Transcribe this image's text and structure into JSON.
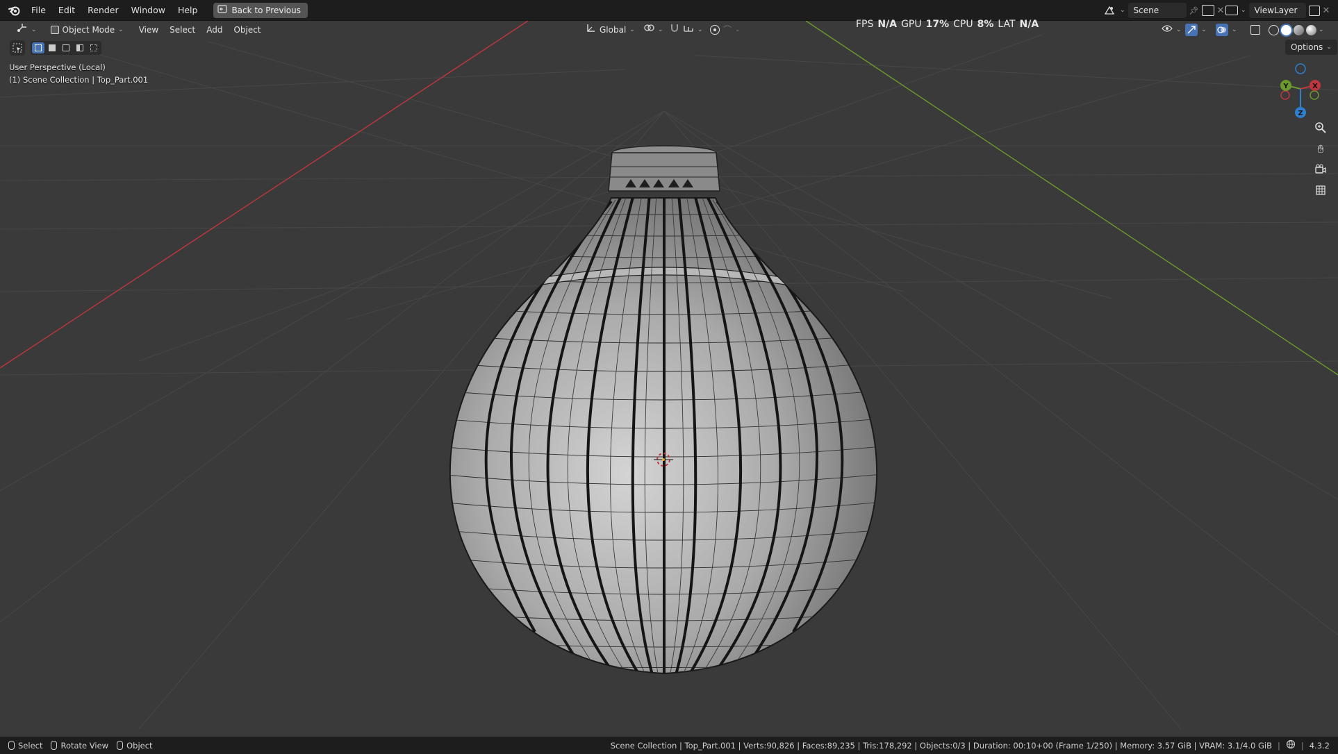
{
  "menu": {
    "items": [
      "File",
      "Edit",
      "Render",
      "Window",
      "Help"
    ],
    "back_button": "Back to Previous"
  },
  "scene_selector": {
    "value": "Scene"
  },
  "viewlayer_selector": {
    "value": "ViewLayer"
  },
  "viewport_header": {
    "mode": "Object Mode",
    "menus": [
      "View",
      "Select",
      "Add",
      "Object"
    ],
    "transform_orientation": "Global",
    "options_label": "Options"
  },
  "stats": {
    "fps_label": "FPS",
    "fps_value": "N/A",
    "gpu_label": "GPU",
    "gpu_value": "17%",
    "cpu_label": "CPU",
    "cpu_value": "8%",
    "lat_label": "LAT",
    "lat_value": "N/A"
  },
  "viewport_info": {
    "perspective": "User Perspective (Local)",
    "collection": "(1) Scene Collection | Top_Part.001"
  },
  "gizmo": {
    "x": "X",
    "y": "Y",
    "z": "Z"
  },
  "status_bar": {
    "left": [
      {
        "label": "Select"
      },
      {
        "label": "Rotate View"
      },
      {
        "label": "Object"
      }
    ],
    "info": "Scene Collection | Top_Part.001 | Verts:90,826 | Faces:89,235 | Tris:178,292 | Objects:0/3 | Duration: 00:10+00 (Frame 1/250) | Memory: 3.57 GiB | VRAM: 3.1/4.0 GiB",
    "version": "4.3.2"
  },
  "colors": {
    "x_axis": "#c0363f",
    "y_axis": "#6c9a2c",
    "z_axis": "#2f7fd0",
    "accent": "#4772b3"
  }
}
